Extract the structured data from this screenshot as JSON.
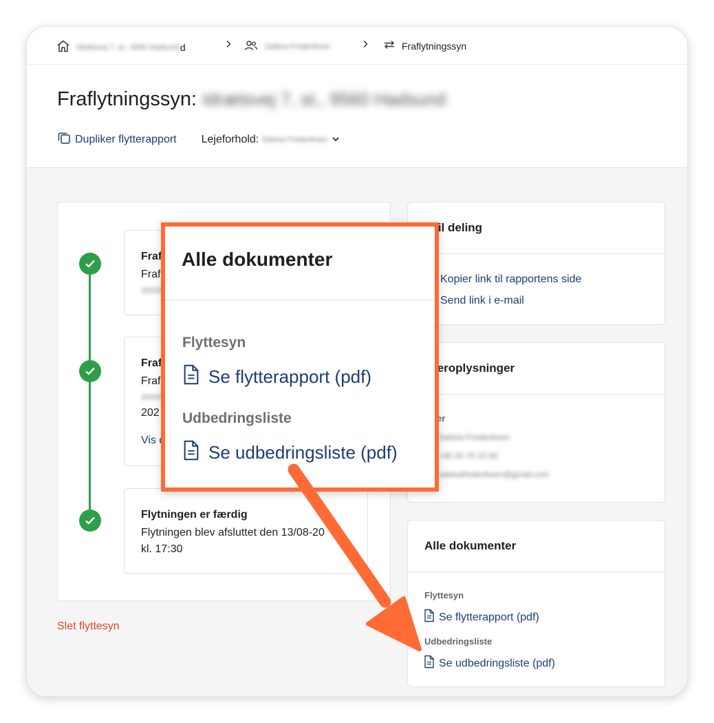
{
  "breadcrumb": {
    "home_text": "Idrætsvej 7, st., 9560 Hadsund",
    "home_visible_tail": "d",
    "tenants_text": "Sabina Frederiksen",
    "current": "Fraflytningssyn"
  },
  "header": {
    "title_prefix": "Fraflytningssyn:",
    "title_address": "Idrætsvej 7, st., 9560 Hadsund",
    "duplicate_label": "Dupliker flytterapport",
    "tenancy_label": "Lejeforhold:",
    "tenancy_value": "Sabina Frederiksen"
  },
  "timeline": {
    "steps": [
      {
        "title": "Fraf",
        "line1": "Fraf",
        "line2": "████████"
      },
      {
        "title": "Fraf",
        "line1": "Fraf",
        "line2": "████████",
        "line3": "202",
        "link": "Vis d"
      },
      {
        "title": "Flytningen er færdig",
        "line1": "Flytningen blev afsluttet den 13/08-20",
        "line2": "kl. 17:30"
      }
    ],
    "delete_label": "Slet flyttesyn"
  },
  "share_card": {
    "title": "Link til deling",
    "title_visible": "k til deling",
    "copy_link": "Kopier link til rapportens side",
    "send_link": "Send link i e-mail"
  },
  "tenant_card": {
    "title_visible": "jeroplysninger",
    "label_visible": "er",
    "name": "Sabina Frederiksen",
    "phone": "+45 20 70 10 90",
    "email": "sabinafrederiksen@gmail.com"
  },
  "docs_card": {
    "title": "Alle dokumenter",
    "section1": "Flyttesyn",
    "link1": "Se flytterapport (pdf)",
    "section2": "Udbedringsliste",
    "link2": "Se udbedringsliste (pdf)"
  },
  "callout": {
    "title": "Alle dokumenter",
    "section1": "Flyttesyn",
    "link1": "Se flytterapport (pdf)",
    "section2": "Udbedringsliste",
    "link2": "Se udbedringsliste (pdf)"
  },
  "colors": {
    "accent_link": "#1c3d73",
    "success": "#2e9e48",
    "danger": "#e0452a",
    "callout": "#ff6a35"
  }
}
